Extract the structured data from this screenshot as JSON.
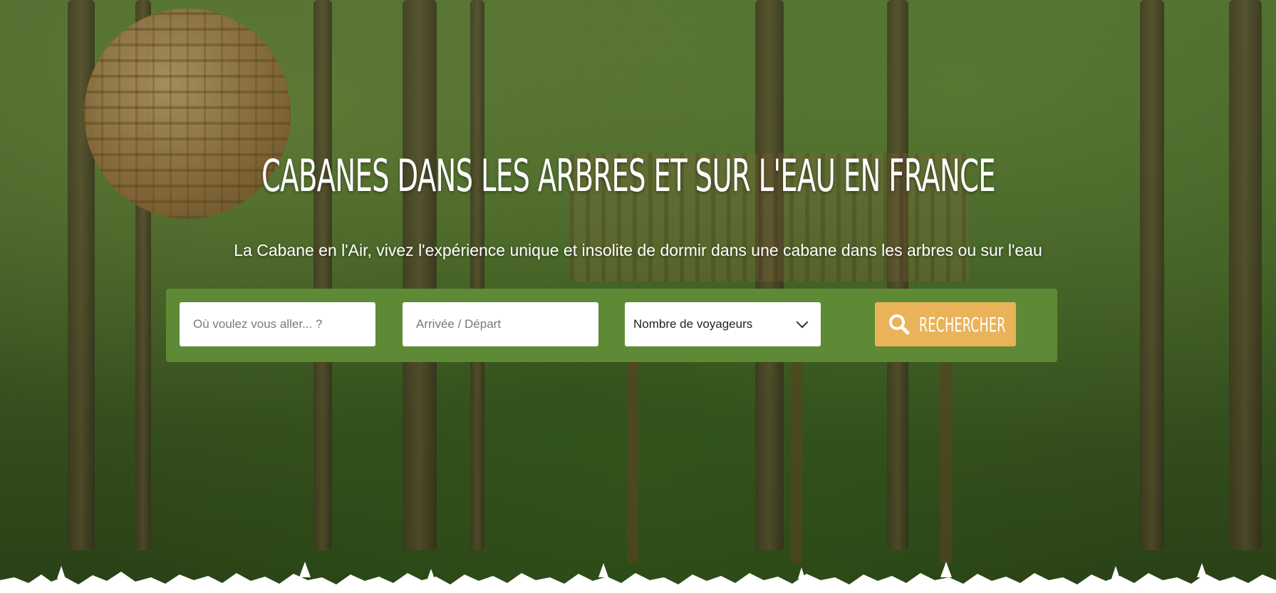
{
  "hero": {
    "title": "CABANES DANS LES ARBRES ET SUR L'EAU EN FRANCE",
    "subtitle": "La Cabane en l'Air, vivez l'expérience unique et insolite de dormir dans une cabane dans les arbres ou sur l'eau"
  },
  "search": {
    "where_placeholder": "Où voulez vous aller... ?",
    "dates_placeholder": "Arrivée / Départ",
    "guests_label": "Nombre de voyageurs",
    "button_label": "RECHERCHER",
    "button_icon": "search-icon",
    "guests_icon": "chevron-down-icon"
  },
  "colors": {
    "search_bar_bg": "#5e8a35",
    "button_bg": "#eab35a",
    "text_on_hero": "#ffffff"
  }
}
